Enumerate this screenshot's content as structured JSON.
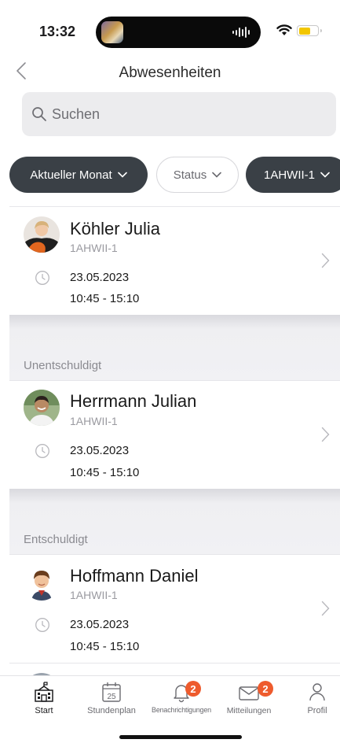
{
  "status_bar": {
    "time": "13:32"
  },
  "nav": {
    "title": "Abwesenheiten"
  },
  "search": {
    "placeholder": "Suchen"
  },
  "filters": [
    {
      "label": "Aktueller Monat",
      "style": "dark"
    },
    {
      "label": "Status",
      "style": "light"
    },
    {
      "label": "1AHWII-1",
      "style": "dark"
    }
  ],
  "sections": [
    {
      "label": "",
      "entries": [
        {
          "name": "Köhler Julia",
          "class": "1AHWII-1",
          "date": "23.05.2023",
          "time": "10:45 - 15:10",
          "avatar": "avatar-woman"
        }
      ]
    },
    {
      "label": "Unentschuldigt",
      "entries": [
        {
          "name": "Herrmann Julian",
          "class": "1AHWII-1",
          "date": "23.05.2023",
          "time": "10:45 - 15:10",
          "avatar": "avatar-man"
        }
      ]
    },
    {
      "label": "Entschuldigt",
      "entries": [
        {
          "name": "Hoffmann Daniel",
          "class": "1AHWII-1",
          "date": "23.05.2023",
          "time": "10:45 - 15:10",
          "avatar": "avatar-boy"
        }
      ]
    }
  ],
  "tabbar": {
    "items": [
      {
        "label": "Start",
        "icon": "school-icon",
        "active": true
      },
      {
        "label": "Stundenplan",
        "icon": "calendar-icon",
        "calendar_day": "25"
      },
      {
        "label": "Benachrichtigungen",
        "icon": "bell-icon",
        "badge": "2"
      },
      {
        "label": "Mitteilungen",
        "icon": "envelope-icon",
        "badge": "2"
      },
      {
        "label": "Profil",
        "icon": "person-icon"
      }
    ]
  },
  "colors": {
    "chip_dark": "#3a4046",
    "badge": "#ee5b2d",
    "section_gap": "#f1f1f4"
  }
}
